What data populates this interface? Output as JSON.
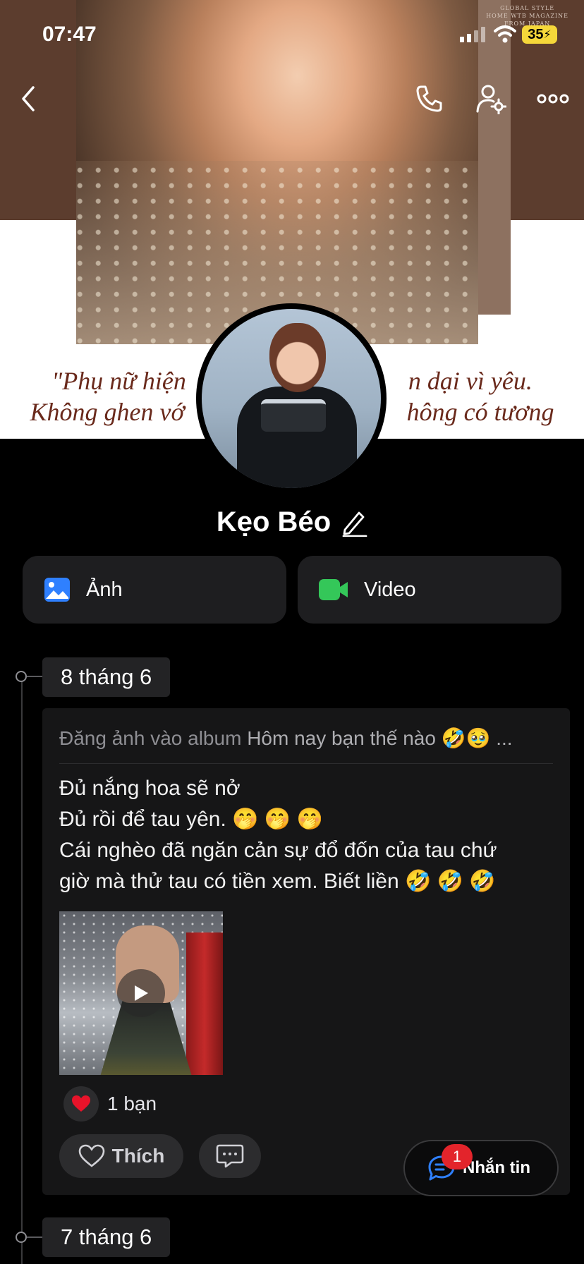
{
  "status_bar": {
    "time": "07:47",
    "battery": "35"
  },
  "cover": {
    "magazine_text": "GLOBAL STYLE\nHOME WTB MAGAZINE\nFROM JAPAN",
    "quote_line1": "\"Phụ nữ hiện                                   n dại vì yêu.",
    "quote_line2": "Không ghen vớ                                   hông có tương"
  },
  "profile": {
    "name": "Kẹo Béo"
  },
  "media": {
    "photos_label": "Ảnh",
    "video_label": "Video"
  },
  "timeline": [
    {
      "date": "8 tháng 6",
      "post": {
        "header_prefix": "Đăng ảnh vào album",
        "header_album": "Hôm nay bạn thế nào 🤣🥹 ...",
        "lines": [
          "Đủ nắng hoa sẽ nở",
          "Đủ rồi để tau yên. 🤭 🤭 🤭",
          "Cái nghèo đã ngăn cản sự đổ đốn của tau chứ",
          "giờ mà thử tau có tiền xem. Biết liền 🤣 🤣 🤣"
        ],
        "reaction_count": "1 bạn",
        "like_label": "Thích"
      }
    },
    {
      "date": "7 tháng 6"
    }
  ],
  "message_button": {
    "label": "Nhắn tin",
    "badge": "1"
  },
  "icons": {
    "back": "chevron-left-icon",
    "call": "phone-icon",
    "settings": "user-settings-icon",
    "more": "more-icon",
    "photos": "image-icon",
    "video": "video-camera-icon",
    "edit": "pencil-icon",
    "heart": "heart-icon",
    "comment": "comment-icon",
    "chat": "chat-bubble-icon"
  },
  "colors": {
    "accent_blue": "#2f80ff",
    "video_green": "#34c759",
    "badge_red": "#e3242b",
    "heart_red": "#e8132a"
  }
}
